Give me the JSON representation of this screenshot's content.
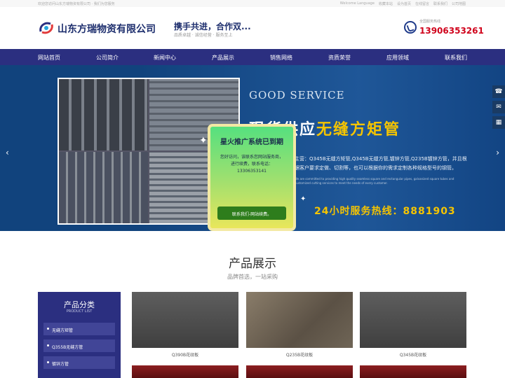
{
  "topbar": {
    "welcome": "欢迎您访问山东方瑞物资有限公司 · 我们为您服务",
    "links": [
      "Welcome Language",
      "收藏本站",
      "设为首页",
      "在线留言",
      "联系我们",
      "公司地图"
    ]
  },
  "header": {
    "company": "山东方瑞物资有限公司",
    "slogan": "携手共进，合作双...",
    "slogan_sub": "品质卓越 · 诚信经营 · 服务至上",
    "phone_label": "全国服务热线",
    "phone": "13906353261"
  },
  "nav": {
    "items": [
      "网站首页",
      "公司简介",
      "新闻中心",
      "产品展示",
      "销售网络",
      "资质荣誉",
      "应用领域",
      "联系我们"
    ]
  },
  "banner": {
    "en_title": "GOOD SERVICE",
    "title_main": "现货供应",
    "title_highlight": "无缝方矩管",
    "desc": "主营：Q345B无缝方矩管,Q345B无缝方管,镀锌方管,Q235B镀锌方管，并且根据客户要求定做、切割等，也可以根据你的需求定制各种规格型号的钢管。",
    "desc_small": "We are committed to providing high quality seamless square and rectangular pipes, galvanized square tubes and customized cutting services to meet the needs of every customer.",
    "hotline": "24小时服务热线：8881903",
    "arrow_left": "‹",
    "arrow_right": "›"
  },
  "float_icons": [
    "phone-icon",
    "chat-icon",
    "qr-code-icon"
  ],
  "products": {
    "title": "产品展示",
    "subtitle": "品牌首选，一站采购",
    "sidebar_title": "产品分类",
    "sidebar_sub": "PRODUCT LIST",
    "categories": [
      "无缝方矩管",
      "Q355B无缝方管",
      "镀锌方管"
    ],
    "items": [
      {
        "label": "Q390B花纹板"
      },
      {
        "label": "Q235B花纹板"
      },
      {
        "label": "Q345B花纹板"
      }
    ]
  },
  "modal": {
    "title": "星火推广系统已到期",
    "body_line1": "您好访问，该联系您网站服务商，",
    "body_line2": "进行续费，联系电话：",
    "body_phone": "13306353141",
    "button": "联系我们-网站续费。"
  },
  "colors": {
    "nav_bg": "#2b2f80",
    "banner_bg": "#11437d",
    "accent_yellow": "#f5c400",
    "phone_red": "#d0021b",
    "modal_button": "#2e7d1c"
  }
}
